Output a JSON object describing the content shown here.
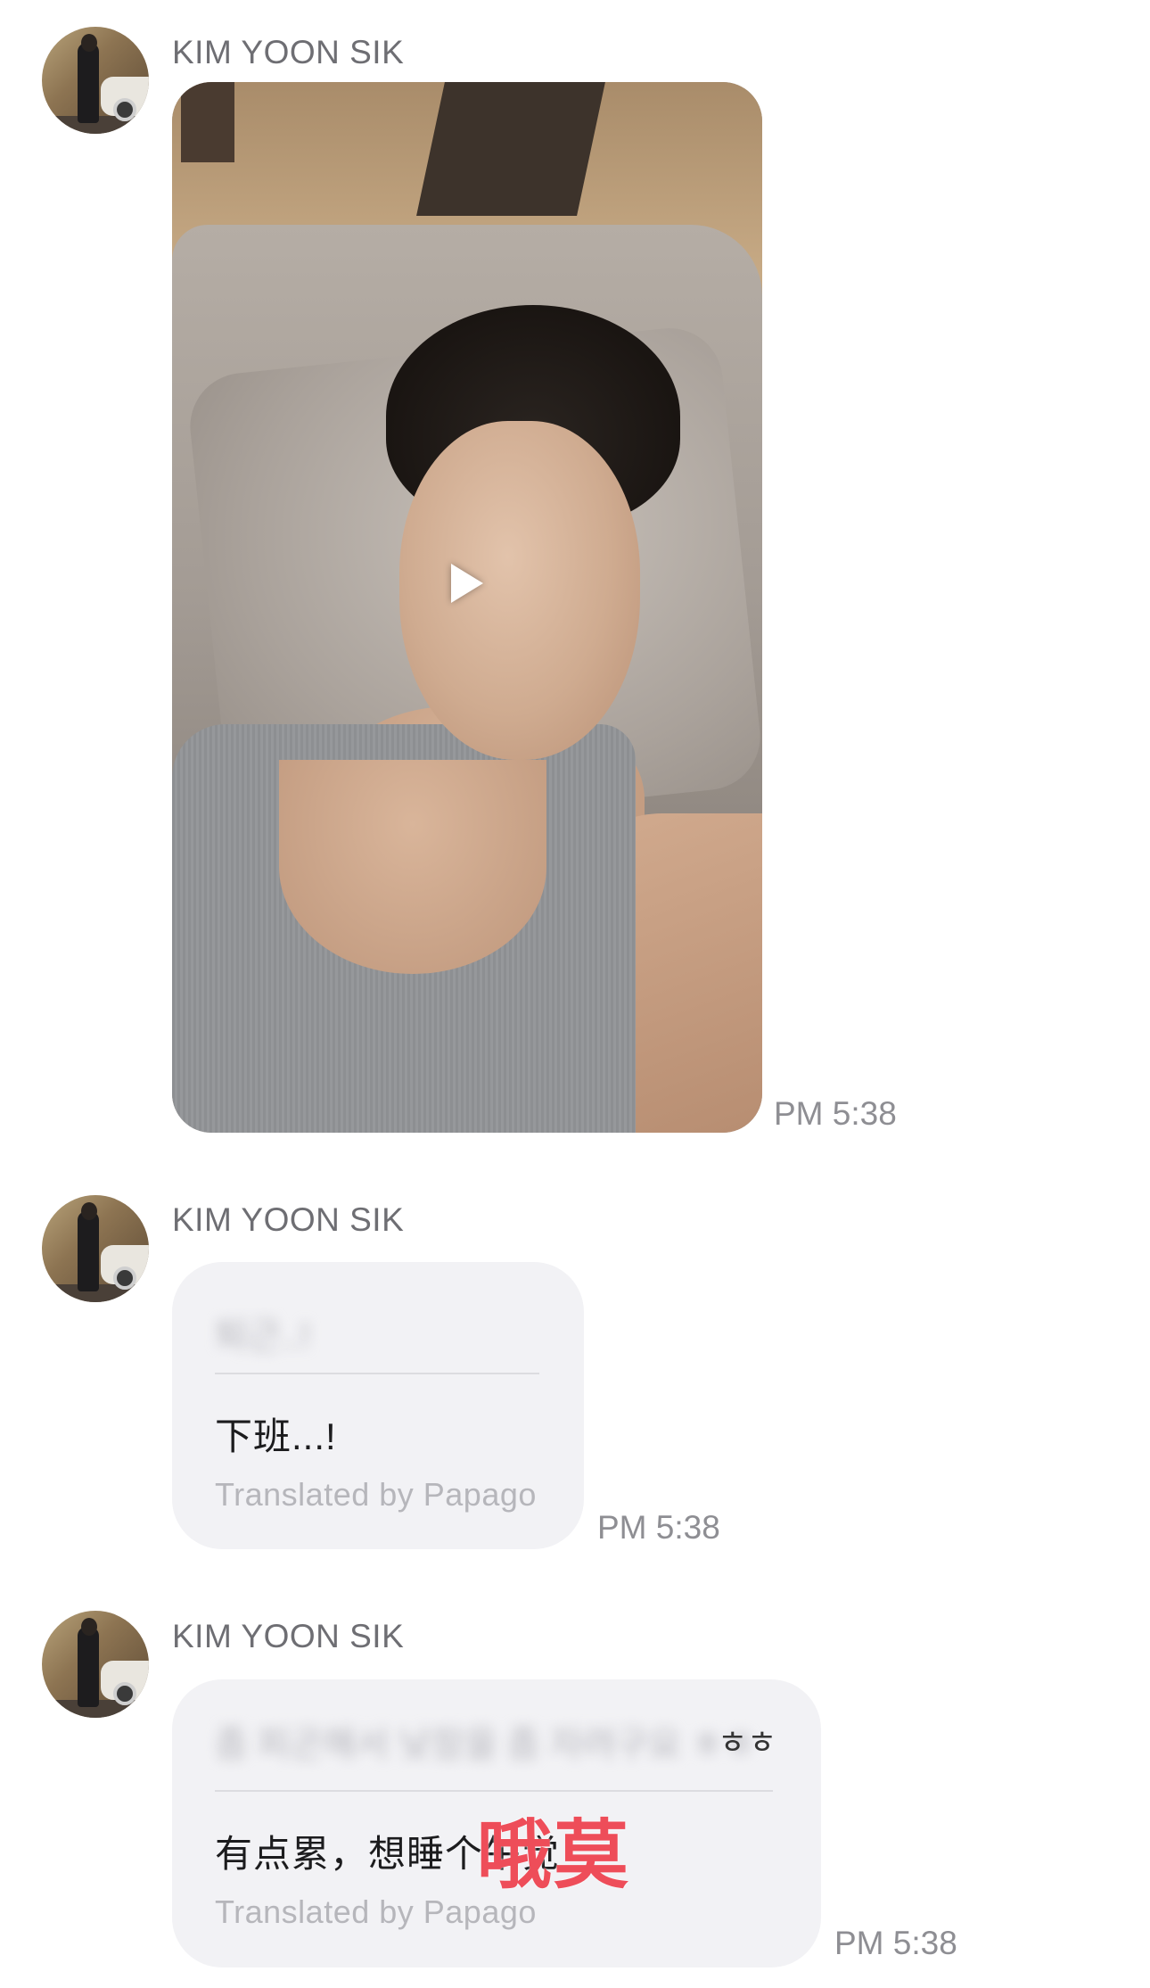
{
  "messages": [
    {
      "sender": "KIM YOON SIK",
      "type": "video",
      "time": "PM 5:38"
    },
    {
      "sender": "KIM YOON SIK",
      "type": "text",
      "original_text": "퇴근..!",
      "translated_text": "下班...!",
      "credit": "Translated by Papago",
      "time": "PM 5:38"
    },
    {
      "sender": "KIM YOON SIK",
      "type": "text",
      "original_text": "좀 피곤해서 낮잠을 좀 자려구요 ㅎㅎ",
      "original_visible_tail": "ㅎㅎ",
      "translated_text": "有点累，想睡个午觉",
      "overlay_text": "哦莫",
      "credit": "Translated by Papago",
      "time": "PM 5:38"
    }
  ],
  "colors": {
    "bubble_bg": "#f2f2f5",
    "sender_text": "#6e6e73",
    "time_text": "#8e8e93",
    "overlay_red": "#ee4d59"
  },
  "icons": {
    "video_play": "play-icon"
  }
}
